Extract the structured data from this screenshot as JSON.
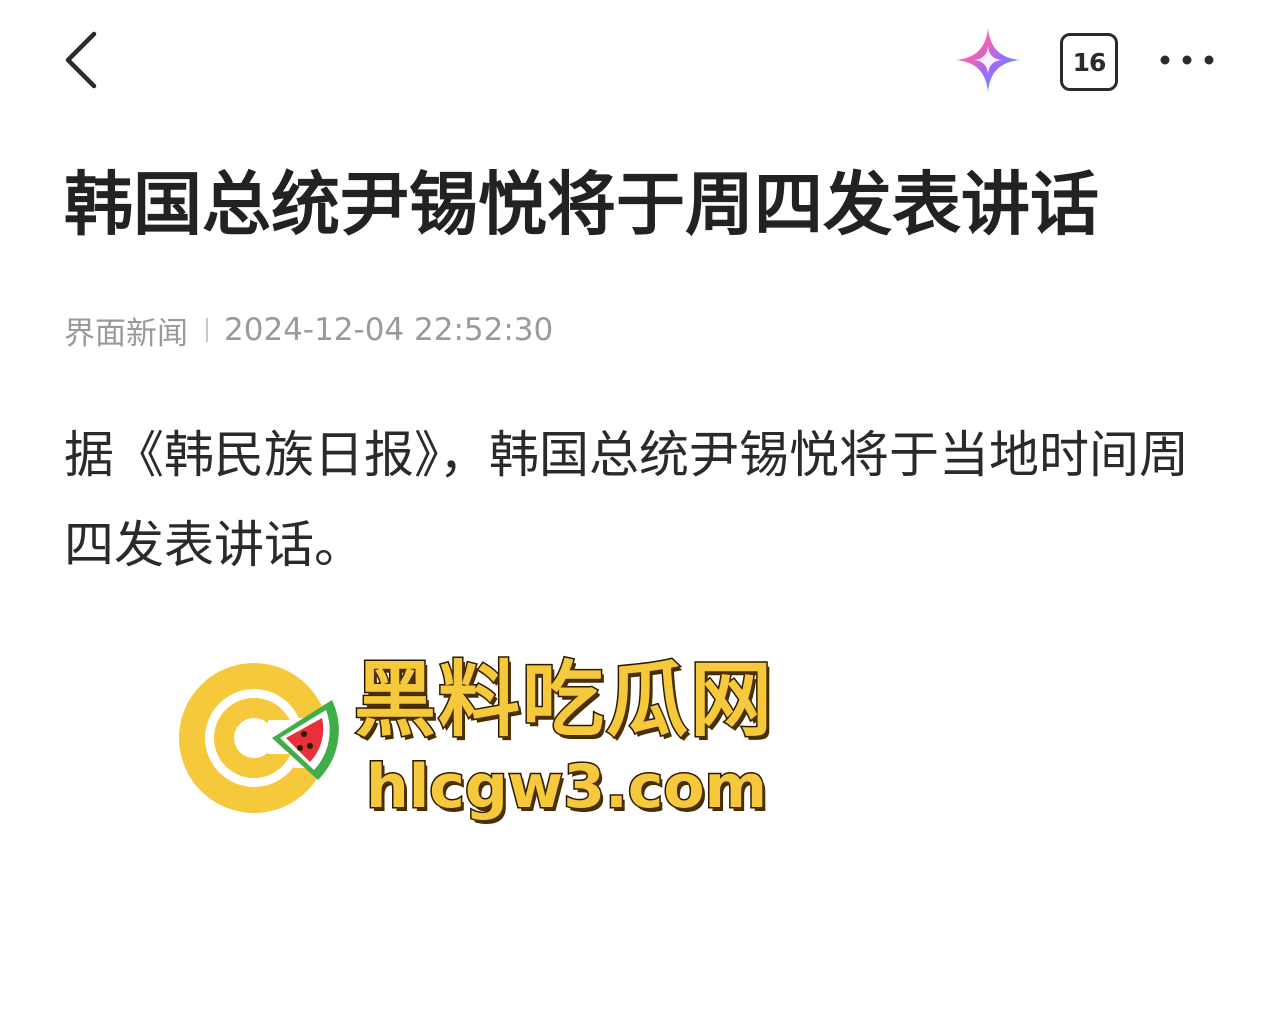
{
  "header": {
    "back_icon": "chevron-left-icon",
    "ai_icon": "sparkle-star-icon",
    "tab_count": "16",
    "more_icon": "more-horizontal-icon"
  },
  "article": {
    "title": "韩国总统尹锡悦将于周四发表讲话",
    "source": "界面新闻",
    "timestamp": "2024-12-04 22:52:30",
    "body": "据《韩民族日报》，韩国总统尹锡悦将于当地时间周四发表讲话。"
  },
  "watermark": {
    "name": "黑料吃瓜网",
    "url": "hlcgw3.com"
  },
  "colors": {
    "title_text": "#222222",
    "meta_text": "#9a9a9a",
    "watermark_yellow": "#f5c93b",
    "watermark_red": "#e8303a",
    "watermark_green": "#3fae49"
  }
}
